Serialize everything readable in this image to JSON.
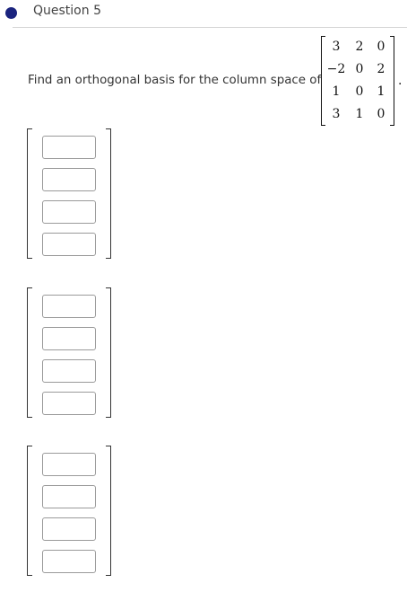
{
  "question": {
    "title": "Question 5"
  },
  "prompt": {
    "text": "Find an orthogonal basis for the column space of",
    "period": "."
  },
  "matrix": {
    "rows": [
      [
        "3",
        "2",
        "0"
      ],
      [
        "−2",
        "0",
        "2"
      ],
      [
        "1",
        "0",
        "1"
      ],
      [
        "3",
        "1",
        "0"
      ]
    ]
  },
  "answer_vectors": [
    {
      "entries": [
        "",
        "",
        "",
        ""
      ]
    },
    {
      "entries": [
        "",
        "",
        "",
        ""
      ]
    },
    {
      "entries": [
        "",
        "",
        "",
        ""
      ]
    }
  ]
}
